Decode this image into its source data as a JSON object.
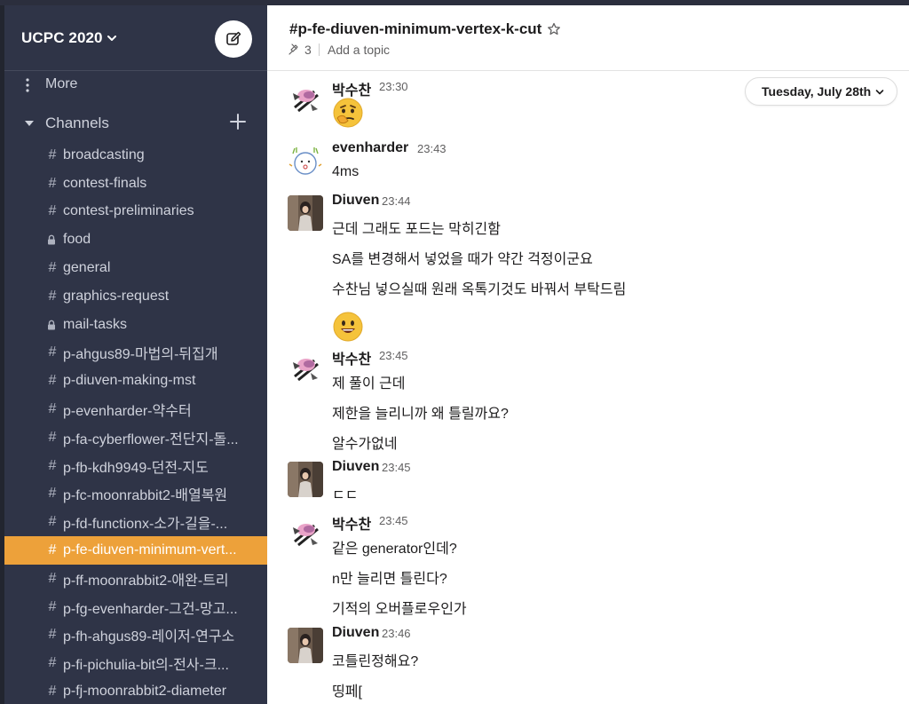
{
  "workspace": {
    "name": "UCPC 2020"
  },
  "sidebar": {
    "more_label": "More",
    "channels_label": "Channels",
    "channels": [
      {
        "prefix": "#",
        "name": "broadcasting",
        "active": false
      },
      {
        "prefix": "#",
        "name": "contest-finals",
        "active": false
      },
      {
        "prefix": "#",
        "name": "contest-preliminaries",
        "active": false
      },
      {
        "prefix": "lock",
        "name": "food",
        "active": false
      },
      {
        "prefix": "#",
        "name": "general",
        "active": false
      },
      {
        "prefix": "#",
        "name": "graphics-request",
        "active": false
      },
      {
        "prefix": "lock",
        "name": "mail-tasks",
        "active": false
      },
      {
        "prefix": "#",
        "name": "p-ahgus89-마법의-뒤집개",
        "active": false
      },
      {
        "prefix": "#",
        "name": "p-diuven-making-mst",
        "active": false
      },
      {
        "prefix": "#",
        "name": "p-evenharder-약수터",
        "active": false
      },
      {
        "prefix": "#",
        "name": "p-fa-cyberflower-전단지-돌...",
        "active": false
      },
      {
        "prefix": "#",
        "name": "p-fb-kdh9949-던전-지도",
        "active": false
      },
      {
        "prefix": "#",
        "name": "p-fc-moonrabbit2-배열복원",
        "active": false
      },
      {
        "prefix": "#",
        "name": "p-fd-functionx-소가-길을-...",
        "active": false
      },
      {
        "prefix": "#",
        "name": "p-fe-diuven-minimum-vert...",
        "active": true
      },
      {
        "prefix": "#",
        "name": "p-ff-moonrabbit2-애완-트리",
        "active": false
      },
      {
        "prefix": "#",
        "name": "p-fg-evenharder-그건-망고...",
        "active": false
      },
      {
        "prefix": "#",
        "name": "p-fh-ahgus89-레이저-연구소",
        "active": false
      },
      {
        "prefix": "#",
        "name": "p-fi-pichulia-bit의-전사-크...",
        "active": false
      },
      {
        "prefix": "#",
        "name": "p-fj-moonrabbit2-diameter",
        "active": false
      }
    ]
  },
  "channel_header": {
    "title": "#p-fe-diuven-minimum-vertex-k-cut",
    "pin_count": "3",
    "topic_placeholder": "Add a topic"
  },
  "date_divider": "Tuesday, July 28th",
  "messages": [
    {
      "sender": "박수찬",
      "time": "23:30",
      "avatar": "plant-avatar",
      "lines": [],
      "emoji": "thinking-face"
    },
    {
      "sender": "evenharder",
      "time": "23:43",
      "avatar": "doodle-avatar",
      "lines": [
        "4ms"
      ]
    },
    {
      "sender": "Diuven",
      "time": "23:44",
      "avatar": "photo-avatar",
      "lines": [
        "근데 그래도 포드는 막히긴함",
        "SA를 변경해서 넣었을 때가 약간 걱정이군요",
        "수찬님 넣으실때 원래 옥톡기것도 바꿔서 부탁드림"
      ],
      "emoji": "smiling-face"
    },
    {
      "sender": "박수찬",
      "time": "23:45",
      "avatar": "plant-avatar",
      "lines": [
        "제 풀이 근데",
        "제한을 늘리니까 왜 틀릴까요?",
        "알수가없네"
      ]
    },
    {
      "sender": "Diuven",
      "time": "23:45",
      "avatar": "photo-avatar",
      "lines": [
        "ㄷㄷ"
      ]
    },
    {
      "sender": "박수찬",
      "time": "23:45",
      "avatar": "plant-avatar",
      "lines": [
        "같은 generator인데?",
        "n만 늘리면 틀린다?",
        "기적의 오버플로우인가"
      ]
    },
    {
      "sender": "Diuven",
      "time": "23:46",
      "avatar": "photo-avatar",
      "lines": [
        "코틀린정해요?",
        "띵페["
      ]
    }
  ]
}
